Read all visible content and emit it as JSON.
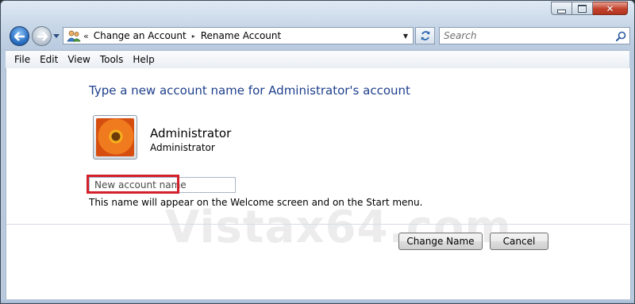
{
  "window": {
    "close_glyph": "✕"
  },
  "nav": {
    "back_icon": "back-arrow-icon",
    "forward_icon": "forward-arrow-icon",
    "refresh_icon": "refresh-icon"
  },
  "address_bar": {
    "chevrons": "«",
    "breadcrumbs": [
      "Change an Account",
      "Rename Account"
    ],
    "separator": "▸",
    "dropdown_glyph": "▼"
  },
  "search": {
    "placeholder": "Search"
  },
  "menu": {
    "items": [
      "File",
      "Edit",
      "View",
      "Tools",
      "Help"
    ]
  },
  "content": {
    "heading": "Type a new account name for Administrator's account",
    "account": {
      "name": "Administrator",
      "type": "Administrator"
    },
    "new_name_input": {
      "placeholder": "New account name",
      "value": ""
    },
    "hint": "This name will appear on the Welcome screen and on the Start menu.",
    "watermark": "Vistax64.com"
  },
  "buttons": {
    "change_name": "Change Name",
    "cancel": "Cancel"
  },
  "colors": {
    "heading": "#1e3f8c",
    "highlight": "#d3202b",
    "close_button": "#c2412b"
  }
}
